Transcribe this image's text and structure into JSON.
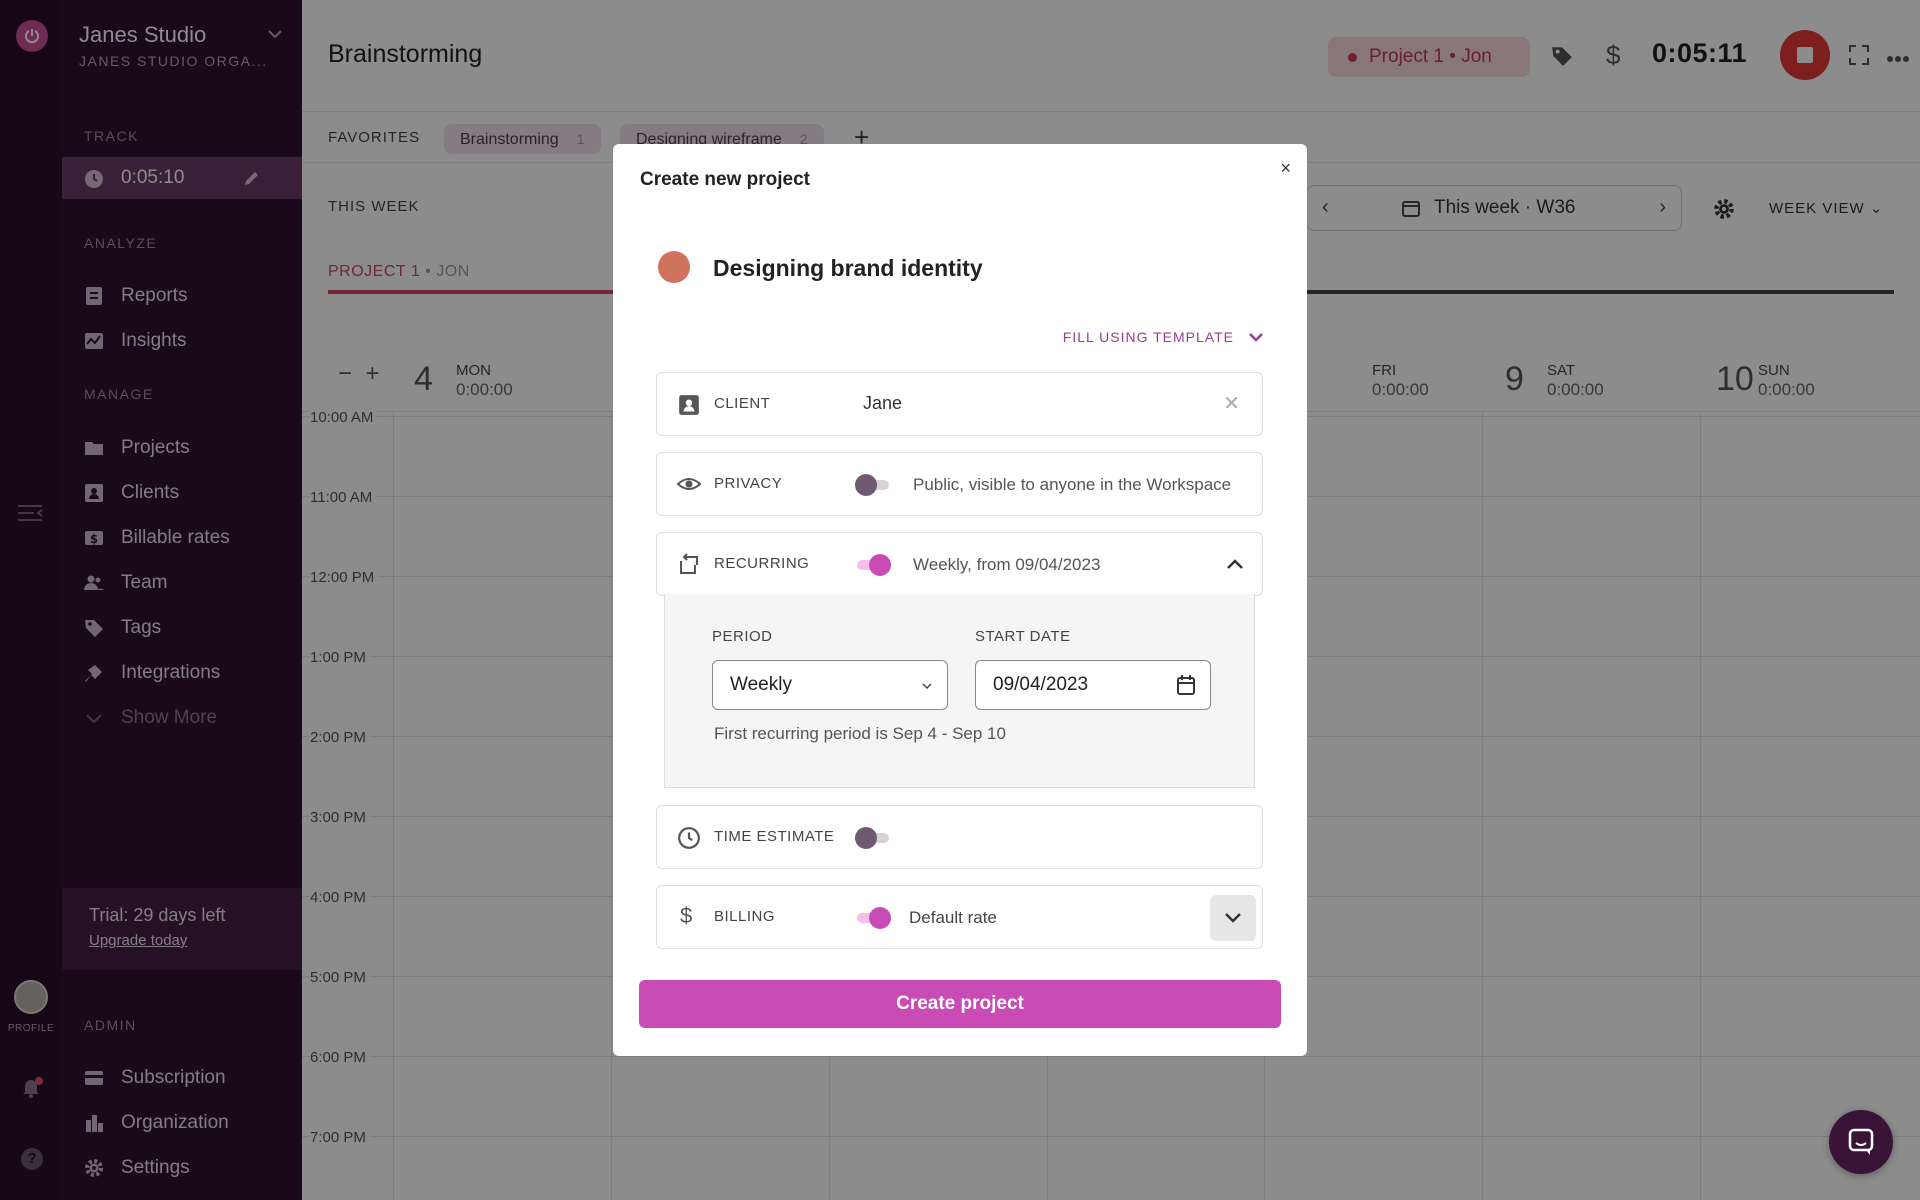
{
  "workspace": {
    "name": "Janes Studio",
    "org": "JANES STUDIO ORGA..."
  },
  "rail": {
    "profile_label": "PROFILE",
    "help_label": "?"
  },
  "sidebar": {
    "track_label": "TRACK",
    "track_time": "0:05:10",
    "analyze_label": "ANALYZE",
    "analyze_items": [
      {
        "label": "Reports",
        "icon": "reports-icon"
      },
      {
        "label": "Insights",
        "icon": "insights-icon"
      }
    ],
    "manage_label": "MANAGE",
    "manage_items": [
      {
        "label": "Projects",
        "icon": "folder-icon"
      },
      {
        "label": "Clients",
        "icon": "client-icon"
      },
      {
        "label": "Billable rates",
        "icon": "dollar-icon"
      },
      {
        "label": "Team",
        "icon": "team-icon"
      },
      {
        "label": "Tags",
        "icon": "tag-icon"
      },
      {
        "label": "Integrations",
        "icon": "plug-icon"
      },
      {
        "label": "Show More",
        "icon": "chevron-down-icon"
      }
    ],
    "trial_text": "Trial: 29 days left",
    "upgrade_link": "Upgrade today",
    "admin_label": "ADMIN",
    "admin_items": [
      {
        "label": "Subscription",
        "icon": "card-icon"
      },
      {
        "label": "Organization",
        "icon": "building-icon"
      },
      {
        "label": "Settings",
        "icon": "gear-icon"
      }
    ]
  },
  "header": {
    "title": "Brainstorming",
    "project_pill": "Project 1 • Jon",
    "timer": "0:05:11"
  },
  "favorites": {
    "label": "FAVORITES",
    "chips": [
      {
        "label": "Brainstorming",
        "count": "1"
      },
      {
        "label": "Designing wireframe",
        "count": "2"
      }
    ]
  },
  "week": {
    "label": "THIS WEEK",
    "project_tab": "PROJECT 1",
    "project_tab_user": "JON",
    "nav_label": "This week · W36",
    "view_label": "WEEK VIEW"
  },
  "calendar": {
    "days": [
      {
        "num": "4",
        "name": "MON",
        "time": "0:00:00"
      },
      {
        "num": "",
        "name": "FRI",
        "time": "0:00:00"
      },
      {
        "num": "9",
        "name": "SAT",
        "time": "0:00:00"
      },
      {
        "num": "10",
        "name": "SUN",
        "time": "0:00:00"
      }
    ],
    "hours": [
      "10:00 AM",
      "11:00 AM",
      "12:00 PM",
      "1:00 PM",
      "2:00 PM",
      "3:00 PM",
      "4:00 PM",
      "5:00 PM",
      "6:00 PM",
      "7:00 PM"
    ]
  },
  "modal": {
    "title": "Create new project",
    "close": "×",
    "project_name": "Designing brand identity",
    "project_color": "#d0735e",
    "template_label": "FILL USING TEMPLATE",
    "client": {
      "label": "CLIENT",
      "value": "Jane"
    },
    "privacy": {
      "label": "PRIVACY",
      "on": false,
      "text": "Public, visible to anyone in the Workspace"
    },
    "recurring": {
      "label": "RECURRING",
      "on": true,
      "text": "Weekly, from 09/04/2023",
      "period_label": "PERIOD",
      "period_value": "Weekly",
      "start_label": "START DATE",
      "start_value": "09/04/2023",
      "note": "First recurring period is Sep 4 - Sep 10"
    },
    "time_estimate": {
      "label": "TIME ESTIMATE",
      "on": false
    },
    "billing": {
      "label": "BILLING",
      "on": true,
      "text": "Default rate"
    },
    "create_button": "Create project"
  },
  "colors": {
    "accent": "#c94bb5",
    "sidebar": "#2f1130",
    "danger": "#e33a3a"
  }
}
